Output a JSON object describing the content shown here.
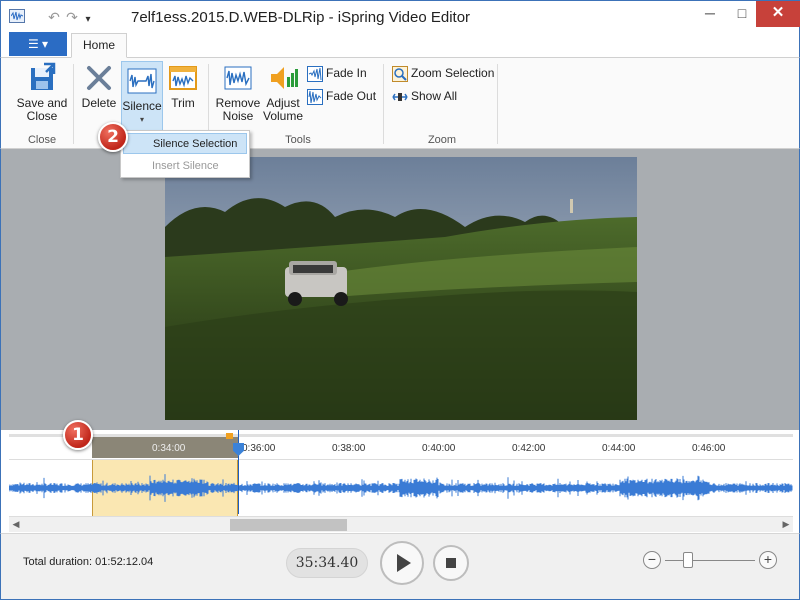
{
  "window": {
    "title": "7elf1ess.2015.D.WEB-DLRip - iSpring Video Editor",
    "close_glyph": "✕",
    "maximize_glyph": "□",
    "minimize_glyph": "─"
  },
  "quick_access": {
    "undo_glyph": "↶",
    "redo_glyph": "↷",
    "customize_glyph": "▾"
  },
  "ribbon": {
    "file_tab_label": "☰ ▾",
    "tabs": [
      {
        "label": "Home"
      }
    ],
    "groups": {
      "close": {
        "label": "Close",
        "save_and_close_label": "Save and\nClose"
      },
      "edit": {
        "delete_label": "Delete",
        "silence_label": "Silence",
        "silence_arrow": "▾",
        "trim_label": "Trim"
      },
      "tools": {
        "label": "Tools",
        "remove_noise_label": "Remove\nNoise",
        "adjust_volume_label": "Adjust\nVolume",
        "fade_in_label": "Fade In",
        "fade_out_label": "Fade Out"
      },
      "zoom": {
        "label": "Zoom",
        "zoom_selection_label": "Zoom Selection",
        "show_all_label": "Show All"
      }
    }
  },
  "silence_menu": {
    "items": [
      {
        "label": "Silence Selection",
        "highlighted": true,
        "enabled": true
      },
      {
        "label": "Insert Silence",
        "highlighted": false,
        "enabled": false
      }
    ]
  },
  "badges": {
    "one": "1",
    "two": "2"
  },
  "timeline": {
    "tick_labels": [
      "0:34:00",
      "0:36:00",
      "0:38:00",
      "0:40:00",
      "0:42:00",
      "0:44:00",
      "0:46:00"
    ],
    "scroll_left_glyph": "◀",
    "scroll_right_glyph": "▶"
  },
  "status": {
    "total_duration": "Total duration: 01:52:12.04",
    "current_time": "35:34.40",
    "zoom_minus": "−",
    "zoom_plus": "+"
  },
  "colors": {
    "accent": "#2b6cc4",
    "selection": "#fae7b2",
    "waveform": "#3a7bd5",
    "badge": "#d0392b"
  }
}
